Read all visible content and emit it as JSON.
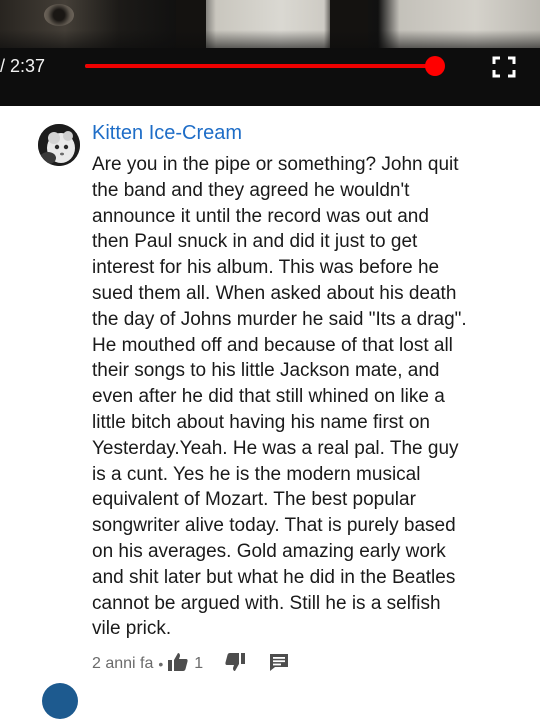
{
  "player": {
    "time": "/ 2:37",
    "progress": 0.995
  },
  "comment": {
    "author": "Kitten Ice-Cream",
    "text_lines": [
      "Are you in the pipe or something? John quit",
      "the band and they agreed he wouldn't",
      "announce it until the record was out and",
      "then Paul snuck in and did it just to get",
      "interest for his album. This was before he",
      "sued them all.  When asked about his death",
      "the day of Johns murder he said \"Its a drag\".",
      "He mouthed off and because of that lost all",
      "their songs to his little Jackson mate, and",
      "even after he did that still whined on like a",
      "little bitch about having his name first on",
      "Yesterday.Yeah. He was a real pal.  The guy",
      "is a cunt.  Yes he is the modern musical",
      "equivalent of Mozart. The best popular",
      "songwriter alive today. That is purely based",
      "on his averages. Gold amazing early work",
      "and shit later but what he did in the Beatles",
      "cannot be argued with. Still he is a selfish",
      "vile prick."
    ],
    "timestamp": "2 anni fa",
    "separator": "•",
    "like_count": "1"
  },
  "icons": {
    "like": "thumbs-up-icon",
    "dislike": "thumbs-down-icon",
    "reply": "reply-icon",
    "fullscreen": "fullscreen-icon"
  },
  "colors": {
    "author": "#1e6dc7",
    "progress": "#ff0000",
    "player_bg": "#0d0d0d"
  }
}
